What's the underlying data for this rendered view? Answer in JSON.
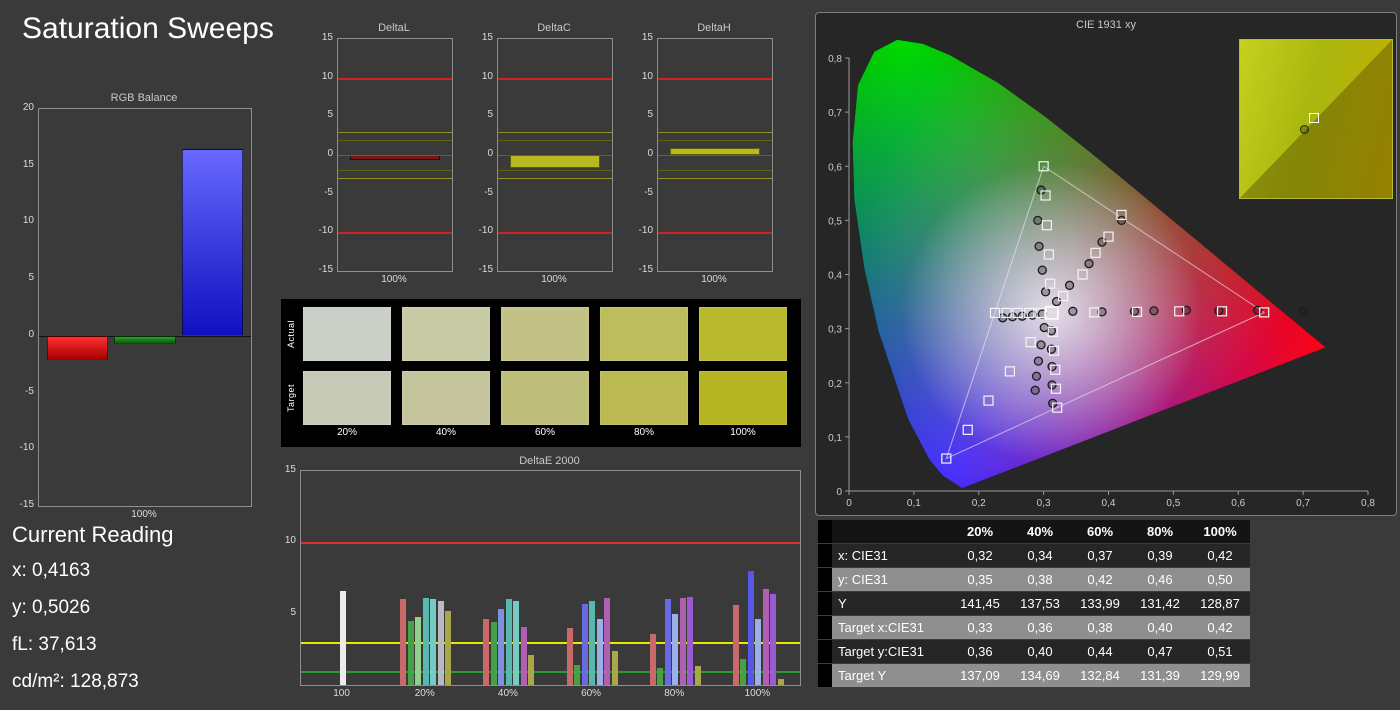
{
  "title": "Saturation Sweeps",
  "rgb_balance": {
    "title": "RGB Balance",
    "x_label": "100%",
    "ylim": [
      -15,
      20
    ],
    "y_ticks": [
      "20",
      "15",
      "10",
      "5",
      "0",
      "-5",
      "-10",
      "-15"
    ],
    "bars": [
      {
        "name": "red",
        "value": -2.1,
        "color": "#ff3030",
        "color2": "#a80000"
      },
      {
        "name": "green",
        "value": -0.7,
        "color": "#28a028",
        "color2": "#0c5c0c"
      },
      {
        "name": "blue",
        "value": 16.5,
        "color": "#6868ff",
        "color2": "#1010c0"
      }
    ]
  },
  "delta_common": {
    "ylim": [
      -15,
      15
    ],
    "y_ticks": [
      "15",
      "10",
      "5",
      "0",
      "-5",
      "-10",
      "-15"
    ],
    "ref_lines": [
      {
        "v": 10,
        "color": "#d42020"
      },
      {
        "v": -10,
        "color": "#d42020"
      },
      {
        "v": 3,
        "color": "#8f8f1f"
      },
      {
        "v": -3,
        "color": "#8f8f1f"
      },
      {
        "v": 2,
        "color": "#62620f"
      },
      {
        "v": -2,
        "color": "#62620f"
      },
      {
        "v": 0,
        "color": "#1a8a1a"
      }
    ]
  },
  "delta_charts": [
    {
      "title": "DeltaL",
      "x_label": "100%",
      "bar": {
        "value": -0.6,
        "color": "#7a1515",
        "border": "#2e0606"
      }
    },
    {
      "title": "DeltaC",
      "x_label": "100%",
      "bar": {
        "value": -1.7,
        "color": "#b8b820",
        "border": "#5c5c08"
      }
    },
    {
      "title": "DeltaH",
      "x_label": "100%",
      "bar": {
        "value": 0.9,
        "color": "#b8b820",
        "border": "#5c5c08"
      }
    }
  ],
  "swatches": {
    "row_labels": [
      "Actual",
      "Target"
    ],
    "col_labels": [
      "20%",
      "40%",
      "60%",
      "80%",
      "100%"
    ],
    "actual": [
      "#cacfc8",
      "#c8caa6",
      "#c2c287",
      "#bdbd5e",
      "#b9b92e"
    ],
    "target": [
      "#c6cab7",
      "#c3c49b",
      "#bfbf7c",
      "#bab952",
      "#b5b523"
    ]
  },
  "deltae_chart": {
    "title": "DeltaE 2000",
    "ylim": [
      0,
      15
    ],
    "y_ticks": [
      "15",
      "10",
      "5"
    ],
    "ref_lines": [
      {
        "v": 10,
        "color": "#e03030",
        "h": 2
      },
      {
        "v": 3,
        "color": "#e8e800",
        "h": 2
      },
      {
        "v": 1,
        "color": "#2a9a2a",
        "h": 2
      }
    ],
    "groups": [
      {
        "label": "100",
        "bars": [
          {
            "v": 6.6,
            "c": "#ececec"
          }
        ]
      },
      {
        "label": "20%",
        "bars": [
          {
            "v": 6.0,
            "c": "#c86a6a"
          },
          {
            "v": 4.5,
            "c": "#46a046"
          },
          {
            "v": 4.8,
            "c": "#8fcf8f"
          },
          {
            "v": 6.1,
            "c": "#58b8b0"
          },
          {
            "v": 6.0,
            "c": "#78cbc4"
          },
          {
            "v": 5.9,
            "c": "#b9b9c2"
          },
          {
            "v": 5.2,
            "c": "#a8a84a"
          }
        ]
      },
      {
        "label": "40%",
        "bars": [
          {
            "v": 4.6,
            "c": "#c86a6a"
          },
          {
            "v": 4.4,
            "c": "#46a046"
          },
          {
            "v": 5.3,
            "c": "#8090e0"
          },
          {
            "v": 6.0,
            "c": "#58b8b0"
          },
          {
            "v": 5.9,
            "c": "#78cbc4"
          },
          {
            "v": 4.1,
            "c": "#b060b0"
          },
          {
            "v": 2.1,
            "c": "#a8a84a"
          }
        ]
      },
      {
        "label": "60%",
        "bars": [
          {
            "v": 4.0,
            "c": "#c86a6a"
          },
          {
            "v": 1.4,
            "c": "#46a046"
          },
          {
            "v": 5.7,
            "c": "#6a6ae0"
          },
          {
            "v": 5.9,
            "c": "#58b8b0"
          },
          {
            "v": 4.6,
            "c": "#9ab0e6"
          },
          {
            "v": 6.1,
            "c": "#b060b0"
          },
          {
            "v": 2.4,
            "c": "#a8a84a"
          }
        ]
      },
      {
        "label": "80%",
        "bars": [
          {
            "v": 3.6,
            "c": "#c86a6a"
          },
          {
            "v": 1.2,
            "c": "#46a046"
          },
          {
            "v": 6.0,
            "c": "#6a6ae0"
          },
          {
            "v": 5.0,
            "c": "#9ab0e6"
          },
          {
            "v": 6.1,
            "c": "#b060b0"
          },
          {
            "v": 6.2,
            "c": "#9a5ad0"
          },
          {
            "v": 1.3,
            "c": "#a8a84a"
          }
        ]
      },
      {
        "label": "100%",
        "bars": [
          {
            "v": 5.6,
            "c": "#c86a6a"
          },
          {
            "v": 1.8,
            "c": "#46a046"
          },
          {
            "v": 8.0,
            "c": "#5858e8"
          },
          {
            "v": 4.6,
            "c": "#9ab0e6"
          },
          {
            "v": 6.7,
            "c": "#b060b0"
          },
          {
            "v": 6.4,
            "c": "#9a5ad0"
          },
          {
            "v": 0.4,
            "c": "#a8a84a"
          }
        ]
      }
    ]
  },
  "cie_chart": {
    "title": "CIE 1931 xy",
    "xlim": [
      0,
      0.8
    ],
    "ylim": [
      0,
      0.8
    ],
    "x_ticks": [
      "0",
      "0,1",
      "0,2",
      "0,3",
      "0,4",
      "0,5",
      "0,6",
      "0,7",
      "0,8"
    ],
    "y_ticks": [
      "0",
      "0,1",
      "0,2",
      "0,3",
      "0,4",
      "0,5",
      "0,6",
      "0,7",
      "0,8"
    ],
    "gamut_triangle": [
      [
        0.64,
        0.33
      ],
      [
        0.3,
        0.6
      ],
      [
        0.15,
        0.06
      ]
    ],
    "white_point": [
      0.3127,
      0.329
    ],
    "sweeps": {
      "yellow": {
        "targets": [
          [
            0.33,
            0.36
          ],
          [
            0.36,
            0.4
          ],
          [
            0.38,
            0.44
          ],
          [
            0.4,
            0.47
          ],
          [
            0.42,
            0.51
          ]
        ],
        "measured": [
          [
            0.32,
            0.35
          ],
          [
            0.34,
            0.38
          ],
          [
            0.37,
            0.42
          ],
          [
            0.39,
            0.46
          ],
          [
            0.42,
            0.5
          ]
        ]
      },
      "red": {
        "targets": [
          [
            0.378,
            0.33
          ],
          [
            0.444,
            0.331
          ],
          [
            0.509,
            0.332
          ],
          [
            0.575,
            0.332
          ],
          [
            0.64,
            0.33
          ]
        ],
        "measured": [
          [
            0.345,
            0.332
          ],
          [
            0.39,
            0.331
          ],
          [
            0.44,
            0.332
          ],
          [
            0.47,
            0.333
          ],
          [
            0.52,
            0.334
          ],
          [
            0.57,
            0.333
          ],
          [
            0.63,
            0.334
          ],
          [
            0.7,
            0.332
          ]
        ]
      },
      "green": {
        "targets": [
          [
            0.31,
            0.383
          ],
          [
            0.308,
            0.437
          ],
          [
            0.305,
            0.491
          ],
          [
            0.303,
            0.546
          ],
          [
            0.3,
            0.6
          ]
        ],
        "measured": [
          [
            0.303,
            0.368
          ],
          [
            0.298,
            0.408
          ],
          [
            0.293,
            0.452
          ],
          [
            0.291,
            0.5
          ],
          [
            0.296,
            0.556
          ]
        ]
      },
      "blue": {
        "targets": [
          [
            0.28,
            0.275
          ],
          [
            0.248,
            0.221
          ],
          [
            0.215,
            0.167
          ],
          [
            0.183,
            0.113
          ],
          [
            0.15,
            0.06
          ]
        ],
        "measured": [
          [
            0.301,
            0.302
          ],
          [
            0.296,
            0.27
          ],
          [
            0.292,
            0.24
          ],
          [
            0.289,
            0.212
          ],
          [
            0.287,
            0.186
          ]
        ]
      },
      "cyan": {
        "targets": [
          [
            0.295,
            0.329
          ],
          [
            0.278,
            0.329
          ],
          [
            0.26,
            0.329
          ],
          [
            0.243,
            0.329
          ],
          [
            0.225,
            0.329
          ]
        ],
        "measured": [
          [
            0.298,
            0.327
          ],
          [
            0.283,
            0.325
          ],
          [
            0.267,
            0.323
          ],
          [
            0.252,
            0.322
          ],
          [
            0.237,
            0.32
          ]
        ]
      },
      "magenta": {
        "targets": [
          [
            0.314,
            0.294
          ],
          [
            0.316,
            0.259
          ],
          [
            0.318,
            0.224
          ],
          [
            0.319,
            0.189
          ],
          [
            0.321,
            0.154
          ]
        ],
        "measured": [
          [
            0.312,
            0.296
          ],
          [
            0.312,
            0.262
          ],
          [
            0.313,
            0.23
          ],
          [
            0.313,
            0.196
          ],
          [
            0.314,
            0.162
          ]
        ]
      }
    },
    "inset": {
      "squares": [
        [
          0.48,
          0.49
        ]
      ],
      "circles": [
        [
          0.42,
          0.56
        ]
      ]
    }
  },
  "current_reading": {
    "heading": "Current Reading",
    "lines": [
      {
        "label": "x:",
        "value": "0,4163"
      },
      {
        "label": "y:",
        "value": "0,5026"
      },
      {
        "label": "fL:",
        "value": "37,613"
      },
      {
        "label": "cd/m²:",
        "value": "128,873"
      }
    ]
  },
  "table": {
    "header": [
      "20%",
      "40%",
      "60%",
      "80%",
      "100%"
    ],
    "rows": [
      {
        "label": "x: CIE31",
        "shade": "dark",
        "values": [
          "0,32",
          "0,34",
          "0,37",
          "0,39",
          "0,42"
        ]
      },
      {
        "label": "y: CIE31",
        "shade": "light",
        "values": [
          "0,35",
          "0,38",
          "0,42",
          "0,46",
          "0,50"
        ]
      },
      {
        "label": "Y",
        "shade": "dark",
        "values": [
          "141,45",
          "137,53",
          "133,99",
          "131,42",
          "128,87"
        ]
      },
      {
        "label": "Target x:CIE31",
        "shade": "light",
        "values": [
          "0,33",
          "0,36",
          "0,38",
          "0,40",
          "0,42"
        ]
      },
      {
        "label": "Target y:CIE31",
        "shade": "dark",
        "values": [
          "0,36",
          "0,40",
          "0,44",
          "0,47",
          "0,51"
        ]
      },
      {
        "label": "Target Y",
        "shade": "light",
        "values": [
          "137,09",
          "134,69",
          "132,84",
          "131,39",
          "129,99"
        ]
      }
    ]
  }
}
